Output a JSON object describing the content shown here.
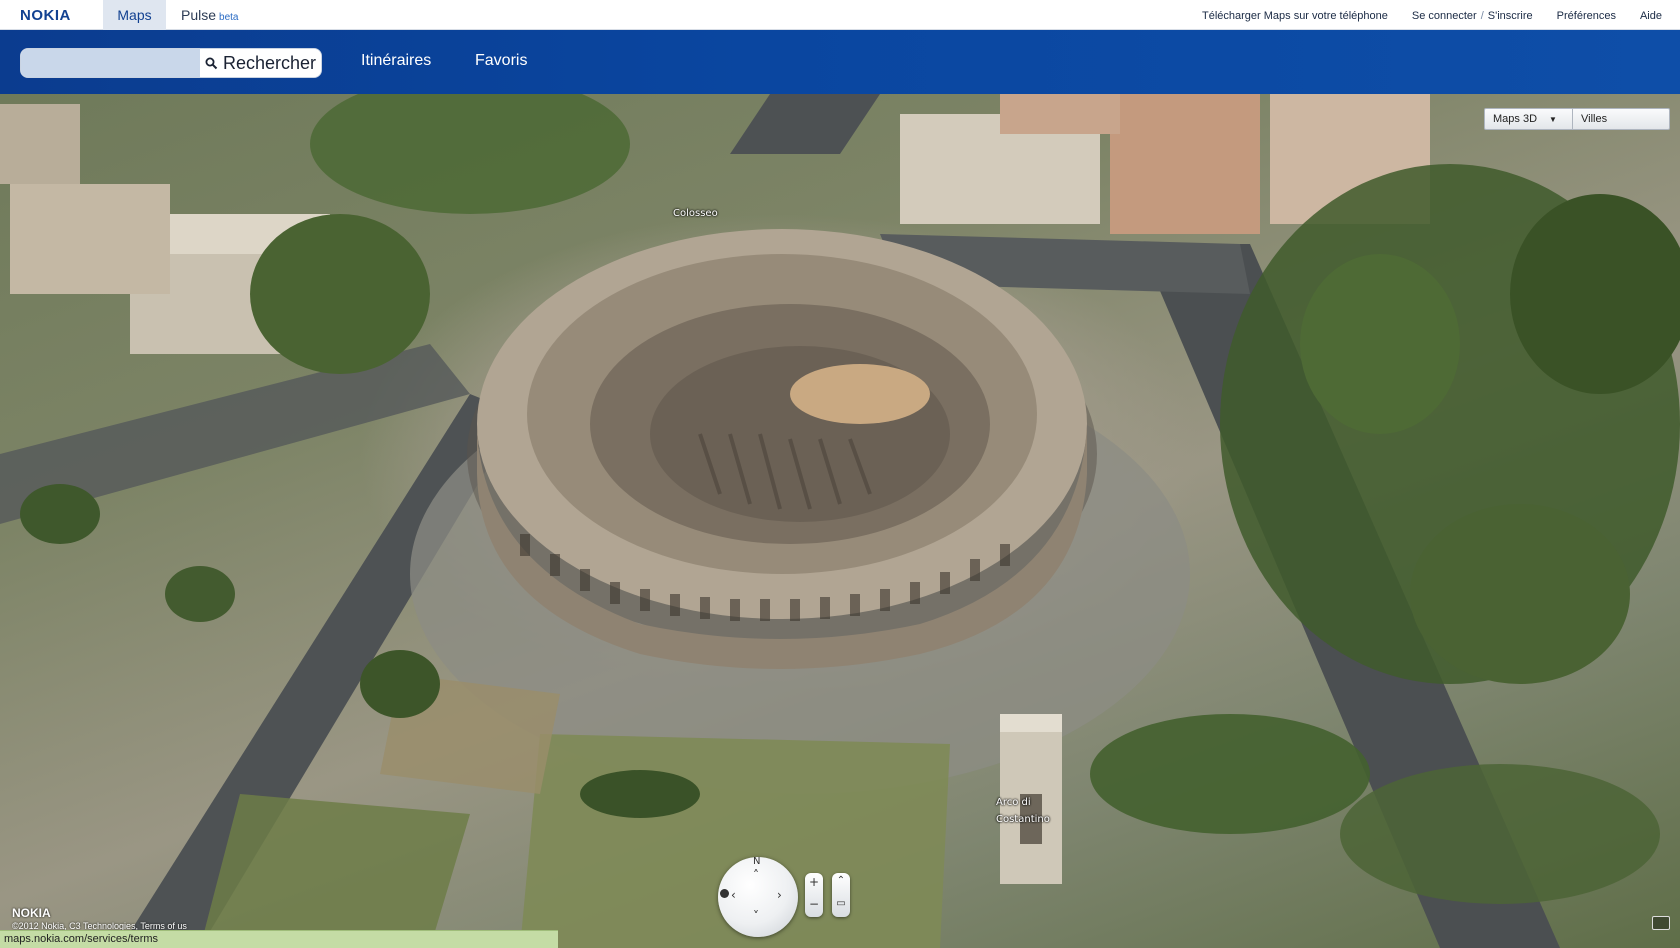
{
  "header": {
    "logo": "NOKIA",
    "tabs": [
      {
        "label": "Maps",
        "active": true
      },
      {
        "label": "Pulse",
        "badge": "beta"
      }
    ],
    "links": {
      "download": "Télécharger Maps sur votre téléphone",
      "login": "Se connecter",
      "separator": "/",
      "signup": "S'inscrire",
      "preferences": "Préférences",
      "help": "Aide"
    }
  },
  "nav": {
    "search": {
      "value": "",
      "placeholder": "",
      "button_label": "Rechercher"
    },
    "links": [
      "Itinéraires",
      "Favoris"
    ]
  },
  "map": {
    "mode": "Maps 3D",
    "layer": "Villes",
    "labels": {
      "colosseo": "Colosseo",
      "arco_line1": "Arco di",
      "arco_line2": "Costantino"
    },
    "compass_north": "N",
    "zoom_in": "+",
    "zoom_out": "−"
  },
  "footer": {
    "logo": "NOKIA",
    "copyright": "©2012 Nokia, C3 Technologies, Terms of us",
    "status_url": "maps.nokia.com/services/terms"
  },
  "colors": {
    "brand_blue": "#124191",
    "nav_blue": "#0a46a0",
    "status_green": "#c4dca5"
  }
}
